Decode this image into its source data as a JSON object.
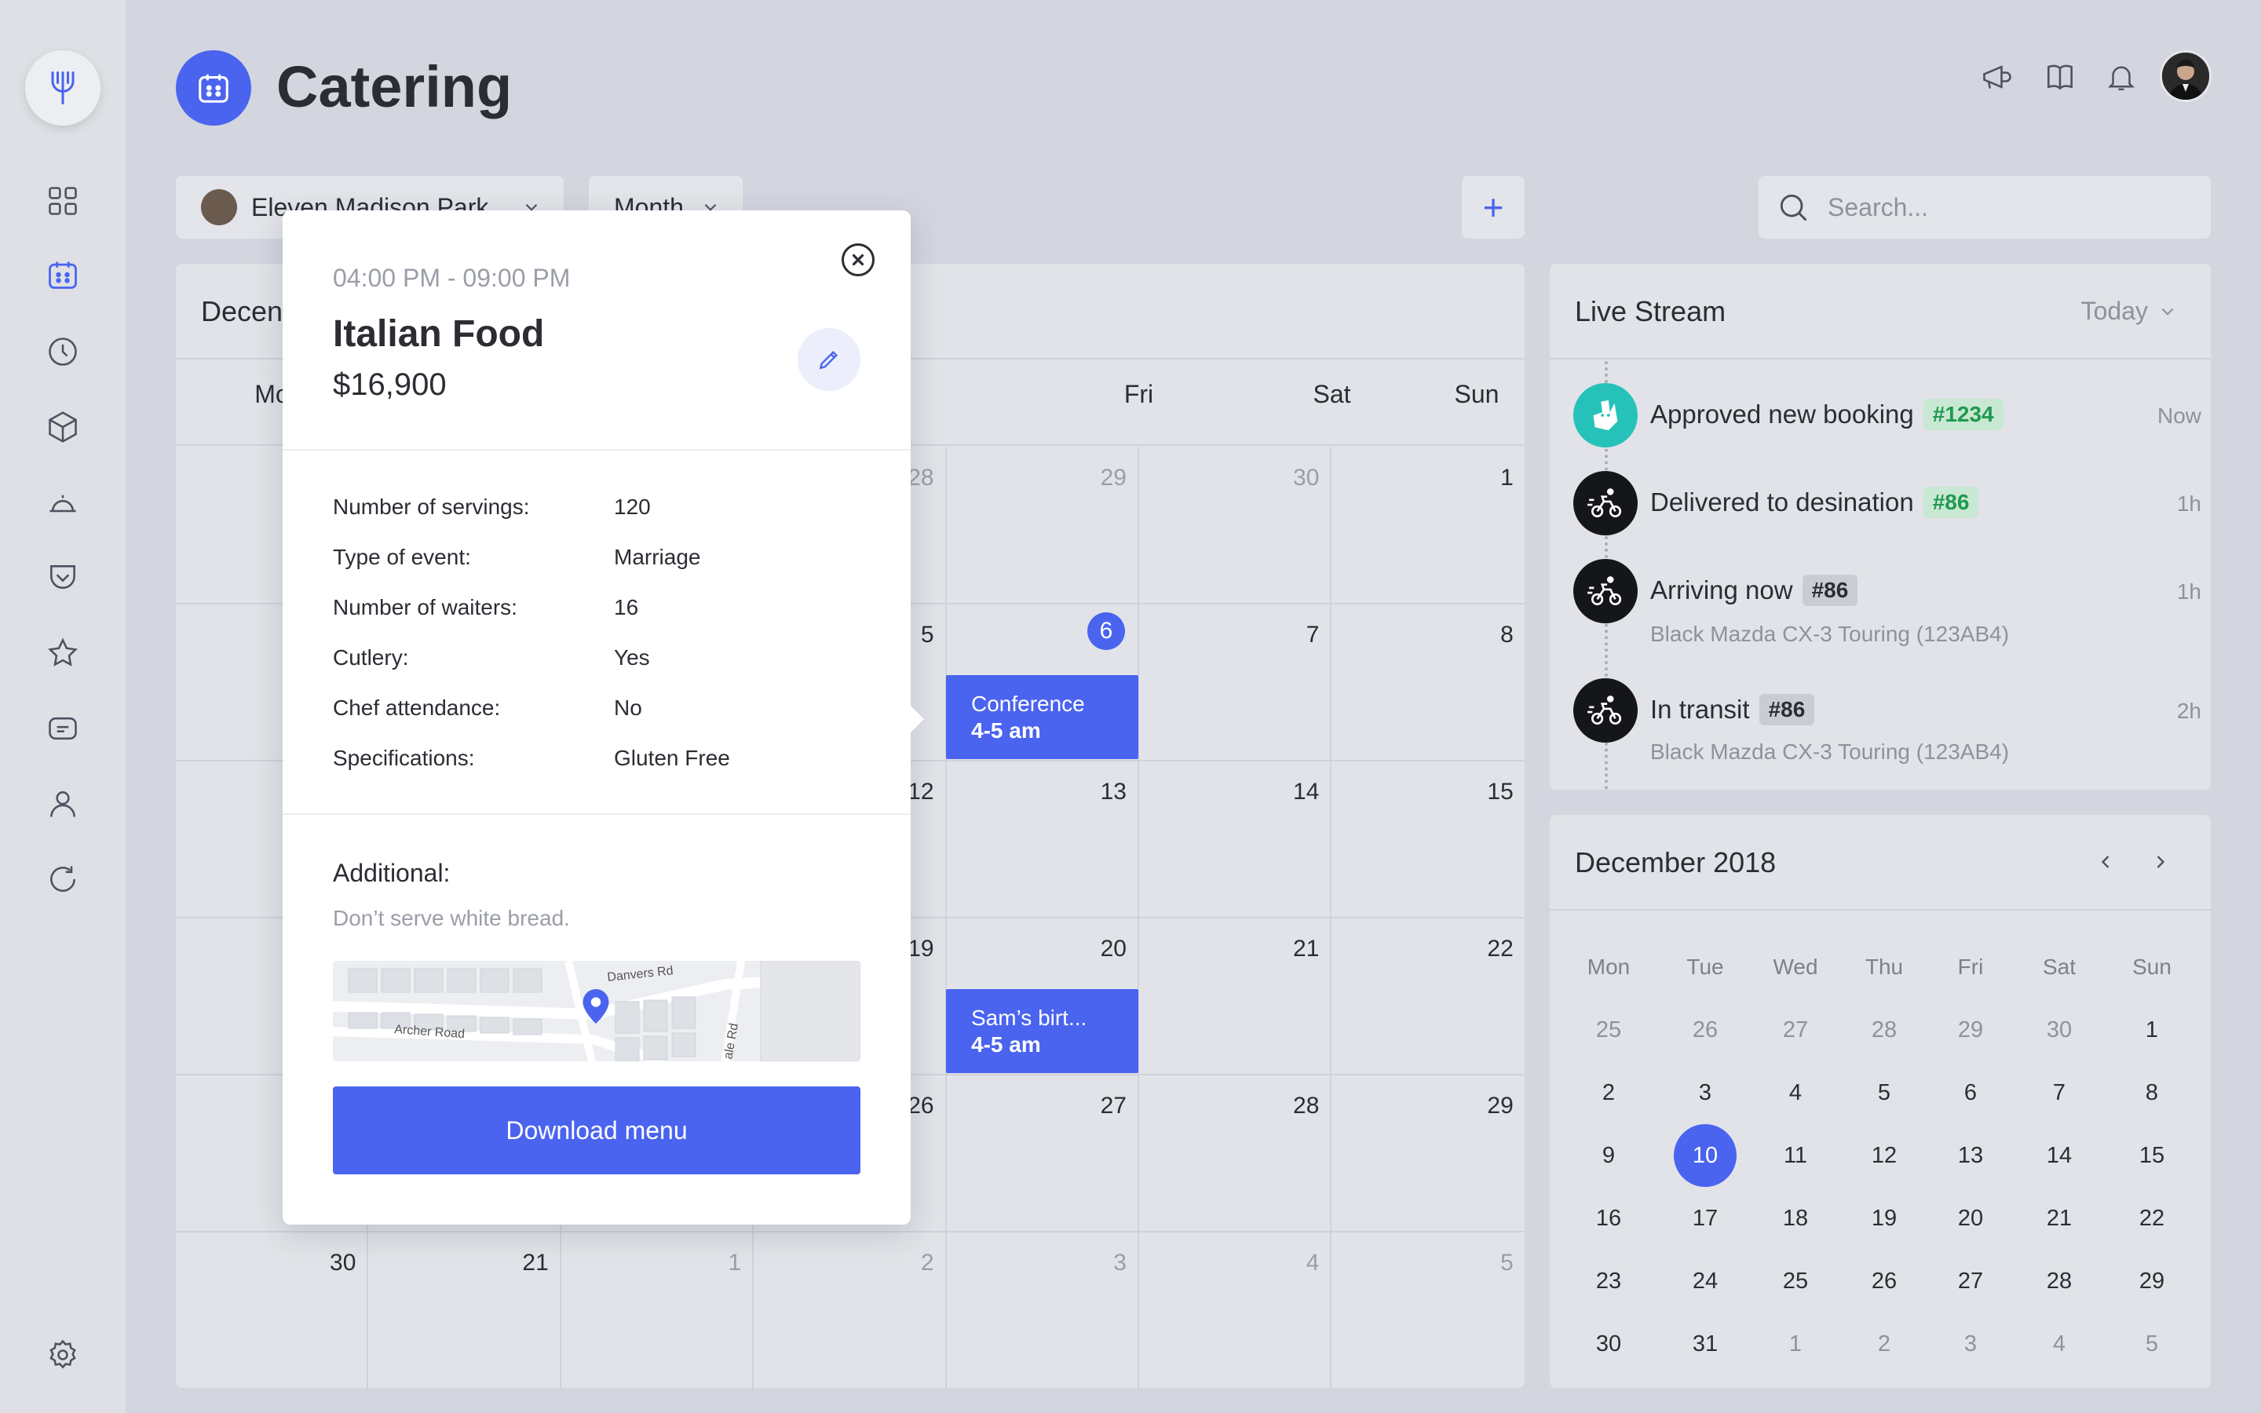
{
  "app": {
    "title": "Catering"
  },
  "toolbar": {
    "restaurant": "Eleven Madison Park",
    "view": "Month",
    "add_label": "+",
    "search_placeholder": "Search..."
  },
  "calendar": {
    "title_partial": "Decen",
    "weekdays": [
      "Mo",
      "",
      "",
      "",
      "Fri",
      "Sat",
      "Sun"
    ],
    "rows": [
      [
        "",
        "",
        "",
        "28",
        "29",
        "30",
        "1"
      ],
      [
        "",
        "",
        "",
        "5",
        "6",
        "7",
        "8"
      ],
      [
        "",
        "",
        "",
        "12",
        "13",
        "14",
        "15"
      ],
      [
        "",
        "",
        "",
        "19",
        "20",
        "21",
        "22"
      ],
      [
        "",
        "",
        "",
        "26",
        "27",
        "28",
        "29"
      ],
      [
        "30",
        "21",
        "1",
        "2",
        "3",
        "4",
        "5"
      ]
    ],
    "events": [
      {
        "title": "Conference",
        "time": "4-5 am"
      },
      {
        "title": "Sam’s birt...",
        "time": "4-5 am"
      }
    ]
  },
  "popup": {
    "time": "04:00 PM - 09:00 PM",
    "title": "Italian Food",
    "price": "$16,900",
    "details": [
      {
        "label": "Number of servings:",
        "value": "120"
      },
      {
        "label": "Type of event:",
        "value": "Marriage"
      },
      {
        "label": "Number of waiters:",
        "value": "16"
      },
      {
        "label": "Cutlery:",
        "value": "Yes"
      },
      {
        "label": "Chef attendance:",
        "value": "No"
      },
      {
        "label": "Specifications:",
        "value": "Gluten Free"
      }
    ],
    "additional_label": "Additional:",
    "additional_text": "Don’t serve white bread.",
    "map_labels": [
      "Danvers Rd",
      "Archer Road",
      "ale Rd"
    ],
    "download_label": "Download menu"
  },
  "live_stream": {
    "title": "Live Stream",
    "filter": "Today",
    "items": [
      {
        "text": "Approved new booking",
        "tag": "#1234",
        "tag_color": "green",
        "time": "Now",
        "sub": ""
      },
      {
        "text": "Delivered to desination",
        "tag": "#86",
        "tag_color": "green",
        "time": "1h",
        "sub": ""
      },
      {
        "text": "Arriving now",
        "tag": "#86",
        "tag_color": "gray",
        "time": "1h",
        "sub": "Black Mazda CX-3 Touring (123AB4)"
      },
      {
        "text": "In transit",
        "tag": "#86",
        "tag_color": "gray",
        "time": "2h",
        "sub": "Black Mazda CX-3 Touring (123AB4)"
      }
    ]
  },
  "mini_calendar": {
    "title": "December 2018",
    "weekdays": [
      "Mon",
      "Tue",
      "Wed",
      "Thu",
      "Fri",
      "Sat",
      "Sun"
    ],
    "rows": [
      [
        "25",
        "26",
        "27",
        "28",
        "29",
        "30",
        "1"
      ],
      [
        "2",
        "3",
        "4",
        "5",
        "6",
        "7",
        "8"
      ],
      [
        "9",
        "10",
        "11",
        "12",
        "13",
        "14",
        "15"
      ],
      [
        "16",
        "17",
        "18",
        "19",
        "20",
        "21",
        "22"
      ],
      [
        "23",
        "24",
        "25",
        "26",
        "27",
        "28",
        "29"
      ],
      [
        "30",
        "31",
        "1",
        "2",
        "3",
        "4",
        "5"
      ]
    ],
    "selected": "10"
  },
  "colors": {
    "accent": "#4a64ef",
    "background": "#d3d6df",
    "card": "#e1e3e8",
    "green_tag": "#1f9a4e"
  },
  "icons": [
    "fork-icon",
    "dashboard-icon",
    "calendar-icon",
    "clock-icon",
    "box-icon",
    "cloche-icon",
    "pocket-icon",
    "star-icon",
    "message-icon",
    "user-icon",
    "refresh-icon",
    "settings-icon",
    "megaphone-icon",
    "book-icon",
    "bell-icon",
    "search-icon",
    "close-icon",
    "edit-icon",
    "chevron-down-icon",
    "chevron-left-icon",
    "chevron-right-icon",
    "map-pin-icon"
  ]
}
